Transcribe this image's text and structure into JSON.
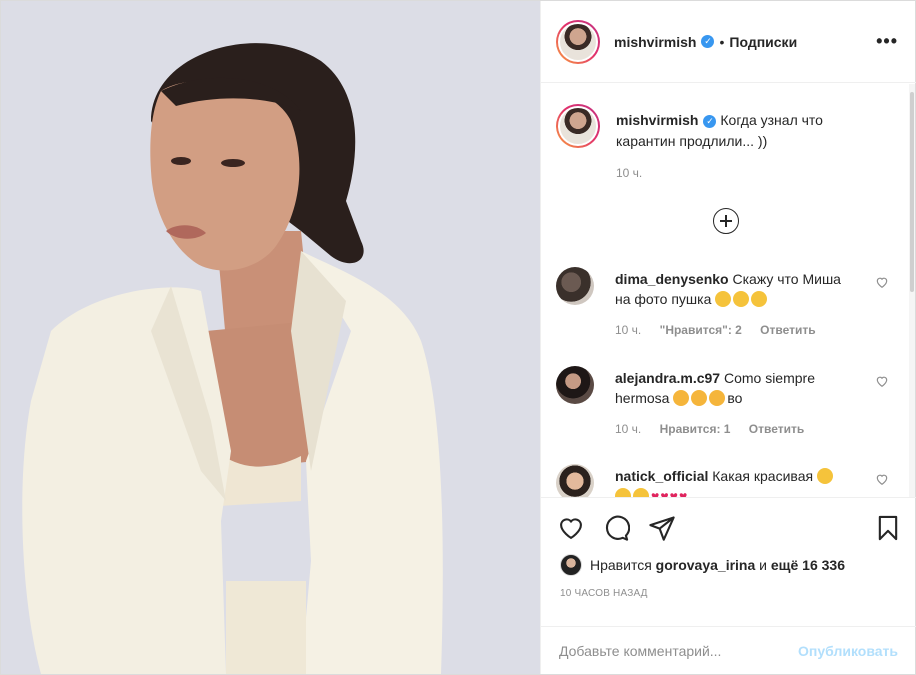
{
  "post": {
    "author": "mishvirmish",
    "follow_state": "Подписки",
    "more_label": "•••",
    "verified_mark": "✓"
  },
  "caption": {
    "username": "mishvirmish",
    "text": "Когда узнал что карантин продлили... ))",
    "time": "10 ч."
  },
  "comments": [
    {
      "username": "dima_denysenko",
      "text": "Скажу что Миша на фото пушка",
      "emojis": [
        "laughing-emoji",
        "winking-emoji",
        "neutral-emoji"
      ],
      "time": "10 ч.",
      "likes": "\"Нравится\": 2",
      "reply": "Ответить"
    },
    {
      "username": "alejandra.m.c97",
      "text_before": "Como siempre hermosa",
      "emojis": [
        "kissing-emoji",
        "kissing-emoji",
        "kissing-emoji"
      ],
      "text_after": "во",
      "time": "10 ч.",
      "likes": "Нравится: 1",
      "reply": "Ответить"
    },
    {
      "username": "natick_official",
      "text": "Какая красивая",
      "emojis": [
        "heart-eyes-emoji",
        "heart-eyes-emoji",
        "heart-eyes-emoji",
        "red-heart",
        "red-heart",
        "red-heart",
        "red-heart"
      ]
    }
  ],
  "likes": {
    "prefix": "Нравится",
    "liker": "gorovaya_irina",
    "middle": "и",
    "others": "ещё 16 336"
  },
  "posted_time": "10 часов назад",
  "comment_box": {
    "placeholder": "Добавьте комментарий...",
    "publish_label": "Опубликовать"
  },
  "colors": {
    "verified": "#3897f0",
    "publish_disabled": "#b2dffc",
    "meta_text": "#8e8e8e"
  }
}
